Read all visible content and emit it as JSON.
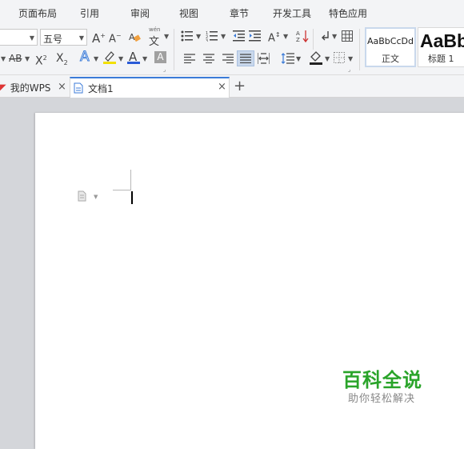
{
  "menu": {
    "items": [
      "页面布局",
      "引用",
      "审阅",
      "视图",
      "章节",
      "开发工具",
      "特色应用"
    ]
  },
  "ribbon": {
    "font_size_value": "五号",
    "wen_label": "文",
    "wen_ruby": "wén",
    "styles": [
      {
        "preview": "AaBbCcDd",
        "name": "正文"
      },
      {
        "preview": "AaBb",
        "name": "标题 1"
      }
    ],
    "colors": {
      "highlight": "#f2e000",
      "font_color": "#2a5bd7",
      "accent": "#3b7bd8"
    }
  },
  "tabs": {
    "items": [
      {
        "label": "我的WPS"
      },
      {
        "label": "文档1"
      }
    ],
    "new_tab_symbol": "+",
    "close_symbol": "×"
  },
  "watermark": {
    "title": "百科全说",
    "subtitle": "助你轻松解决"
  }
}
